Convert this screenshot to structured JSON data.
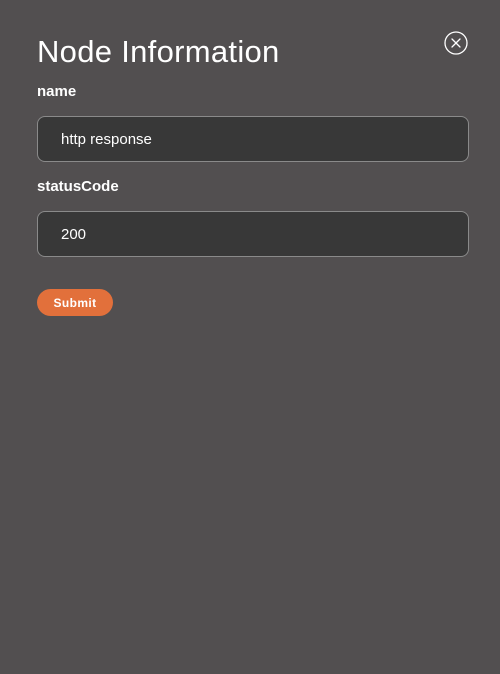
{
  "dialog": {
    "title": "Node Information",
    "close_icon": "close-circle-icon"
  },
  "fields": {
    "name": {
      "label": "name",
      "value": "http response"
    },
    "status_code": {
      "label": "statusCode",
      "value": "200"
    }
  },
  "actions": {
    "submit_label": "Submit"
  },
  "colors": {
    "background": "#524f50",
    "input_background": "#383838",
    "input_border": "#8a8a8a",
    "accent": "#e2703b",
    "text": "#ffffff"
  }
}
